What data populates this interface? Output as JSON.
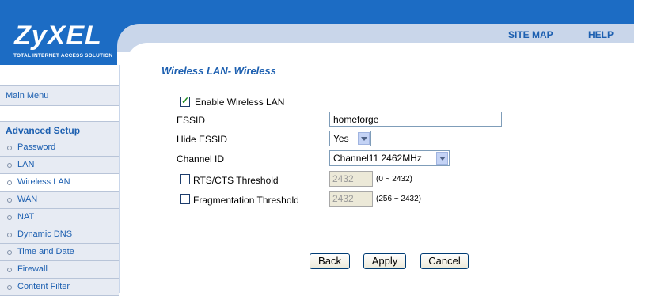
{
  "header": {
    "logo_text": "ZyXEL",
    "logo_subtitle": "TOTAL INTERNET ACCESS SOLUTION",
    "site_map": "SITE MAP",
    "help": "HELP"
  },
  "sidebar": {
    "main_menu": "Main Menu",
    "section_title": "Advanced Setup",
    "items": [
      {
        "label": "Password"
      },
      {
        "label": "LAN"
      },
      {
        "label": "Wireless LAN"
      },
      {
        "label": "WAN"
      },
      {
        "label": "NAT"
      },
      {
        "label": "Dynamic DNS"
      },
      {
        "label": "Time and Date"
      },
      {
        "label": "Firewall"
      },
      {
        "label": "Content Filter"
      }
    ]
  },
  "main": {
    "title": "Wireless LAN- Wireless",
    "enable_label": "Enable Wireless LAN",
    "enable_checked": true,
    "essid_label": "ESSID",
    "essid_value": "homeforge",
    "hide_essid_label": "Hide ESSID",
    "hide_essid_value": "Yes",
    "channel_label": "Channel ID",
    "channel_value": "Channel11 2462MHz",
    "rts_label": "RTS/CTS Threshold",
    "rts_checked": false,
    "rts_value": "2432",
    "rts_range": "(0 ~ 2432)",
    "frag_label": "Fragmentation Threshold",
    "frag_checked": false,
    "frag_value": "2432",
    "frag_range": "(256 ~ 2432)"
  },
  "buttons": {
    "back": "Back",
    "apply": "Apply",
    "cancel": "Cancel"
  }
}
